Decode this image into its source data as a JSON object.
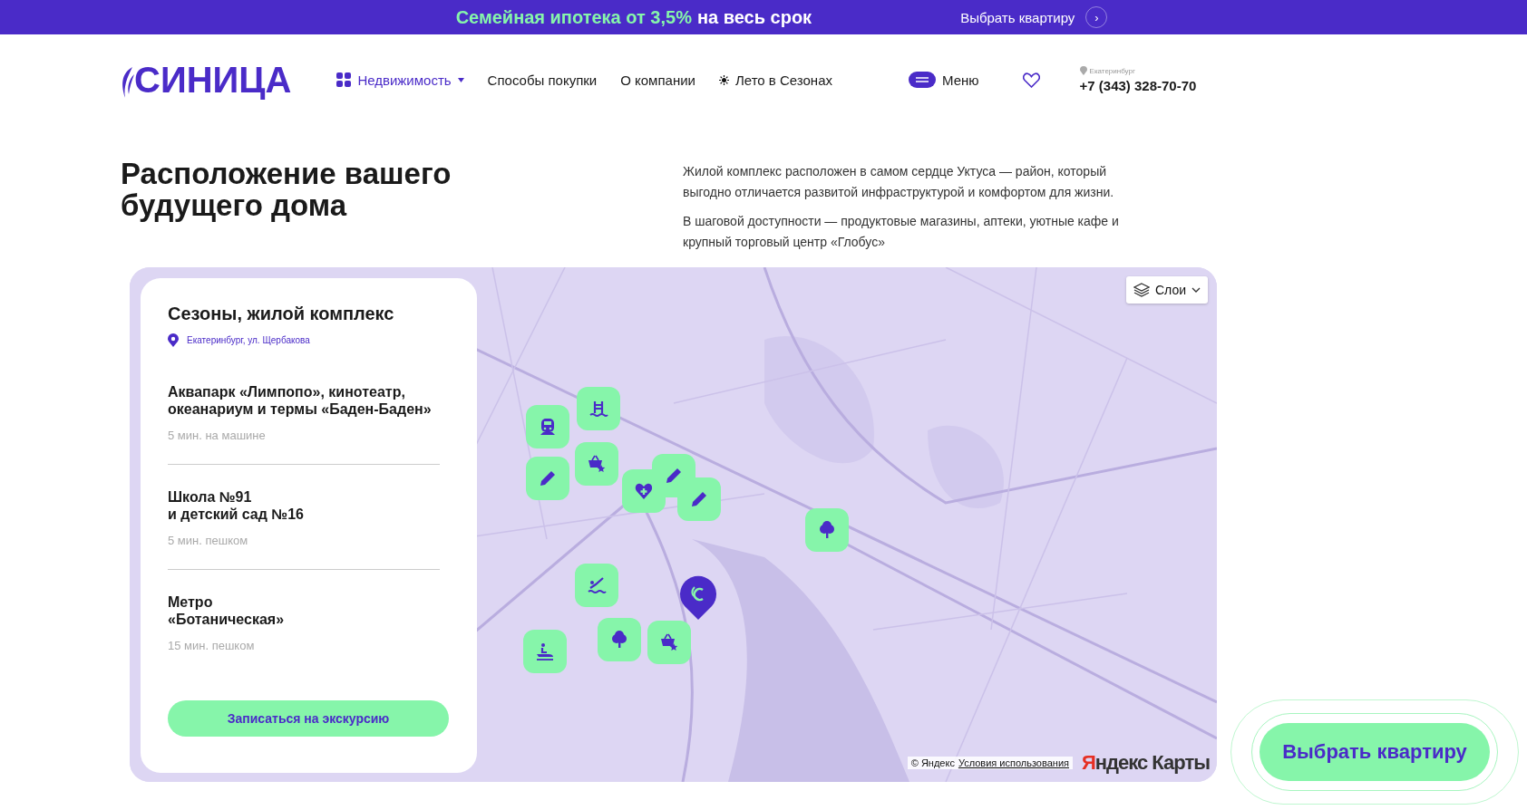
{
  "promo_bar": {
    "highlight": "Семейная ипотека от 3,5%",
    "text": "на весь срок",
    "link": "Выбрать квартиру",
    "arrow": "›"
  },
  "header": {
    "logo": "СИНИЦА",
    "nav": [
      {
        "label": "Недвижимость",
        "kind": "dropdown",
        "selected": true
      },
      {
        "label": "Способы покупки",
        "kind": "link",
        "selected": false
      },
      {
        "label": "О компании",
        "kind": "link",
        "selected": false
      },
      {
        "label": "Лето в Сезонах",
        "kind": "sun",
        "selected": false
      }
    ],
    "menu": "Меню",
    "city": "Екатеринбург",
    "phone": "+7 (343) 328-70-70"
  },
  "intro": {
    "title": "Расположение вашего будущего дома",
    "paragraphs": [
      "Жилой комплекс расположен в самом сердце Уктуса — район, который выгодно отличается развитой инфраструктурой и комфортом для жизни.",
      "В шаговой доступности — продуктовые магазины, аптеки, уютные кафе и крупный торговый центр «Глобус»"
    ]
  },
  "map": {
    "layers": "Слои",
    "copyright": "© Яндекс",
    "terms": "Условия использования",
    "brand_a": "Я",
    "brand_b": "ндекс Карты",
    "pins": [
      {
        "kind": "train"
      },
      {
        "kind": "pool"
      },
      {
        "kind": "pencil"
      },
      {
        "kind": "basket"
      },
      {
        "kind": "heart"
      },
      {
        "kind": "pencil"
      },
      {
        "kind": "pencil"
      },
      {
        "kind": "tree"
      },
      {
        "kind": "swimmer"
      },
      {
        "kind": "jetski"
      },
      {
        "kind": "tree"
      },
      {
        "kind": "basket"
      }
    ],
    "card": {
      "title": "Сезоны, жилой комплекс",
      "address": "Екатеринбург, ул. Щербакова",
      "places": [
        {
          "name": "Аквапарк «Лимпопо», кинотеатр,\nокеанариум и термы «Баден-Баден»",
          "time": "5 мин. на машине"
        },
        {
          "name": "Школа №91\nи детский сад №16",
          "time": "5 мин. пешком"
        },
        {
          "name": "Метро\n«Ботаническая»",
          "time": "15 мин. пешком"
        }
      ],
      "button": "Записаться на экскурсию"
    }
  },
  "floating_button": "Выбрать квартиру"
}
